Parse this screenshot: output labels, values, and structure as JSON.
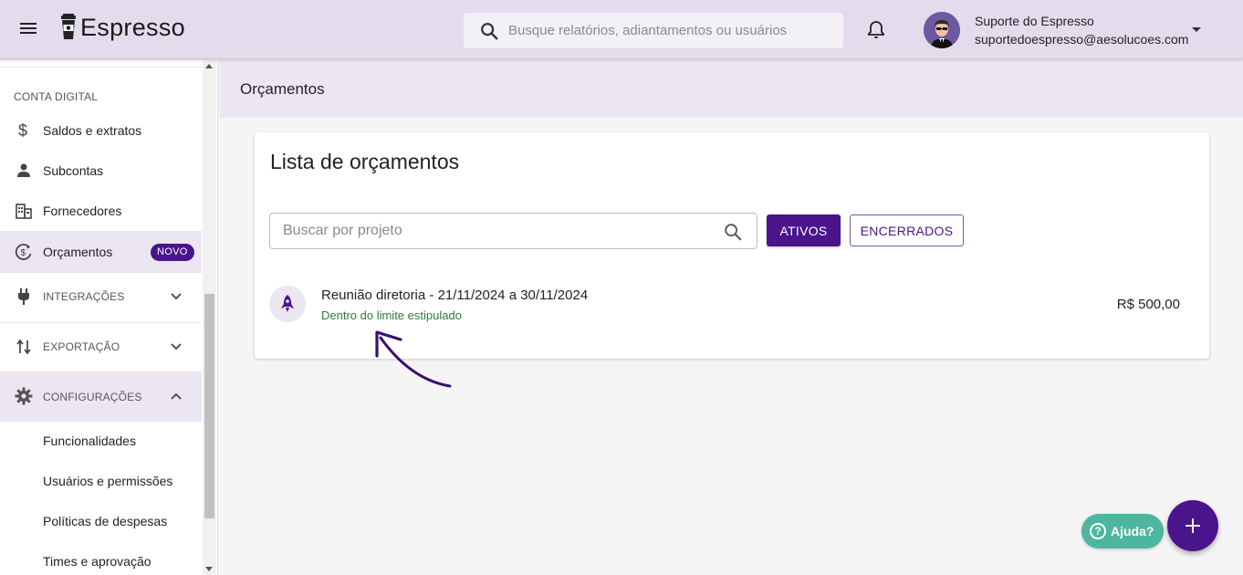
{
  "header": {
    "app_name": "Espresso",
    "search_placeholder": "Busque relatórios, adiantamentos ou usuários",
    "user_name": "Suporte do Espresso",
    "user_email": "suportedoespresso@aesolucoes.com"
  },
  "sidebar": {
    "section_label": "CONTA DIGITAL",
    "items": [
      {
        "label": "Saldos e extratos",
        "icon": "dollar-icon"
      },
      {
        "label": "Subcontas",
        "icon": "person-icon"
      },
      {
        "label": "Fornecedores",
        "icon": "building-icon"
      },
      {
        "label": "Orçamentos",
        "icon": "budget-icon",
        "badge": "NOVO"
      }
    ],
    "groups": [
      {
        "label": "INTEGRAÇÕES",
        "icon": "plug-icon"
      },
      {
        "label": "EXPORTAÇÃO",
        "icon": "swap-vertical-icon"
      },
      {
        "label": "CONFIGURAÇÕES",
        "icon": "gear-icon"
      }
    ],
    "sub_items": [
      {
        "label": "Funcionalidades"
      },
      {
        "label": "Usuários e permissões"
      },
      {
        "label": "Políticas de despesas"
      },
      {
        "label": "Times e aprovação"
      }
    ]
  },
  "page": {
    "title": "Orçamentos",
    "card_title": "Lista de orçamentos",
    "search_placeholder": "Buscar por projeto",
    "filter_active": "ATIVOS",
    "filter_closed": "ENCERRADOS",
    "budgets": [
      {
        "name": "Reunião diretoria - 21/11/2024 a 30/11/2024",
        "status": "Dentro do limite estipulado",
        "value": "R$ 500,00"
      }
    ]
  },
  "help": {
    "label": "Ajuda?"
  },
  "colors": {
    "brand": "#4a148c",
    "header_bg": "#e4dced",
    "status_ok": "#2e7d32",
    "help_bg": "#4db6a0"
  }
}
